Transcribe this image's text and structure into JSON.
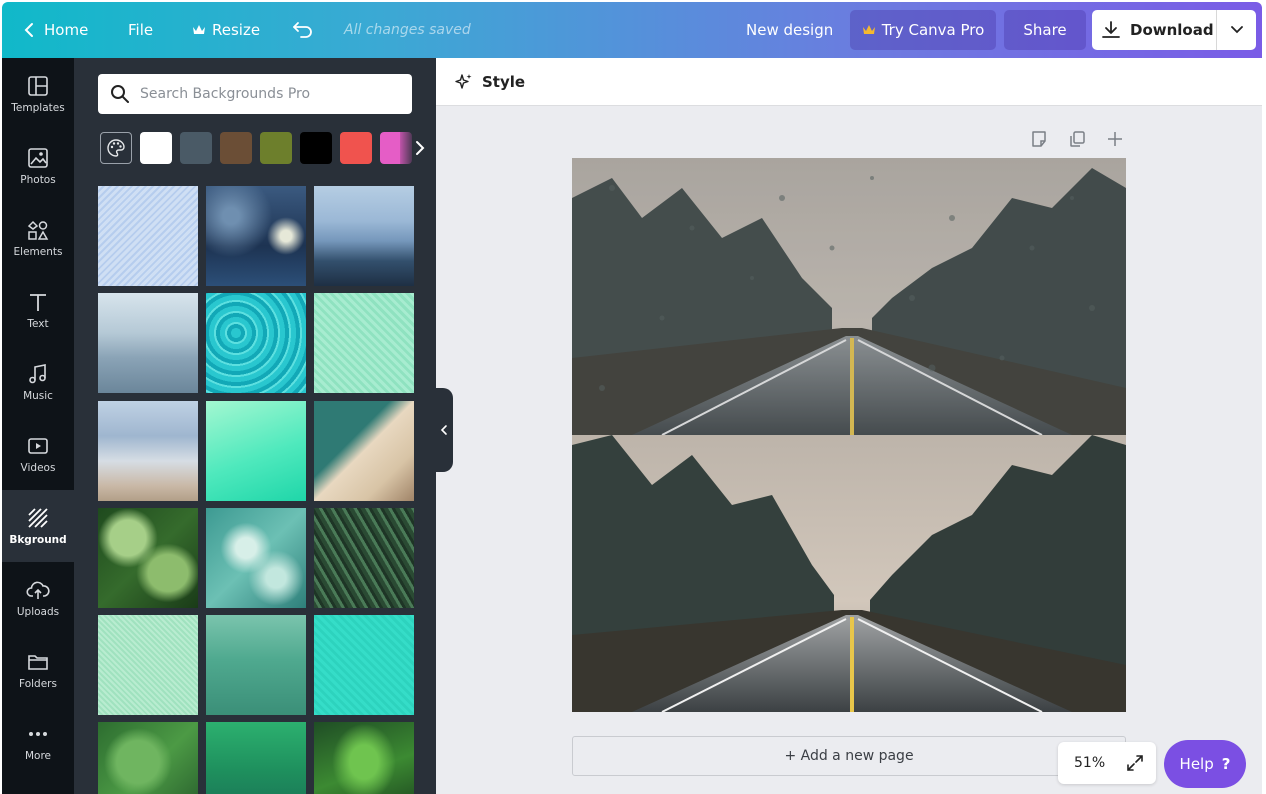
{
  "header": {
    "home_label": "Home",
    "file_label": "File",
    "resize_label": "Resize",
    "saved_status": "All changes saved",
    "new_design_label": "New design",
    "try_pro_label": "Try Canva Pro",
    "share_label": "Share",
    "download_label": "Download"
  },
  "sidebar": {
    "items": [
      {
        "label": "Templates",
        "icon": "templates-icon"
      },
      {
        "label": "Photos",
        "icon": "photos-icon"
      },
      {
        "label": "Elements",
        "icon": "elements-icon"
      },
      {
        "label": "Text",
        "icon": "text-icon"
      },
      {
        "label": "Music",
        "icon": "music-icon"
      },
      {
        "label": "Videos",
        "icon": "videos-icon"
      },
      {
        "label": "Bkground",
        "icon": "background-icon",
        "active": true
      },
      {
        "label": "Uploads",
        "icon": "uploads-icon"
      },
      {
        "label": "Folders",
        "icon": "folders-icon"
      },
      {
        "label": "More",
        "icon": "more-icon"
      }
    ]
  },
  "panel": {
    "search_placeholder": "Search Backgrounds Pro",
    "swatch_colors": [
      "#ffffff",
      "#4a5a66",
      "#6b4e36",
      "#6d7f2c",
      "#000000",
      "#f0534e",
      "#e55dc6"
    ]
  },
  "canvas": {
    "style_label": "Style",
    "add_page_label": "+ Add a new page",
    "zoom_label": "51%",
    "help_label": "Help",
    "help_icon_text": "?"
  },
  "colors": {
    "header_gradient_start": "#10b9c9",
    "header_gradient_end": "#7a5ce6",
    "rail_bg": "#0e1318",
    "panel_bg": "#293039",
    "help_bg": "#7b4fe3"
  }
}
